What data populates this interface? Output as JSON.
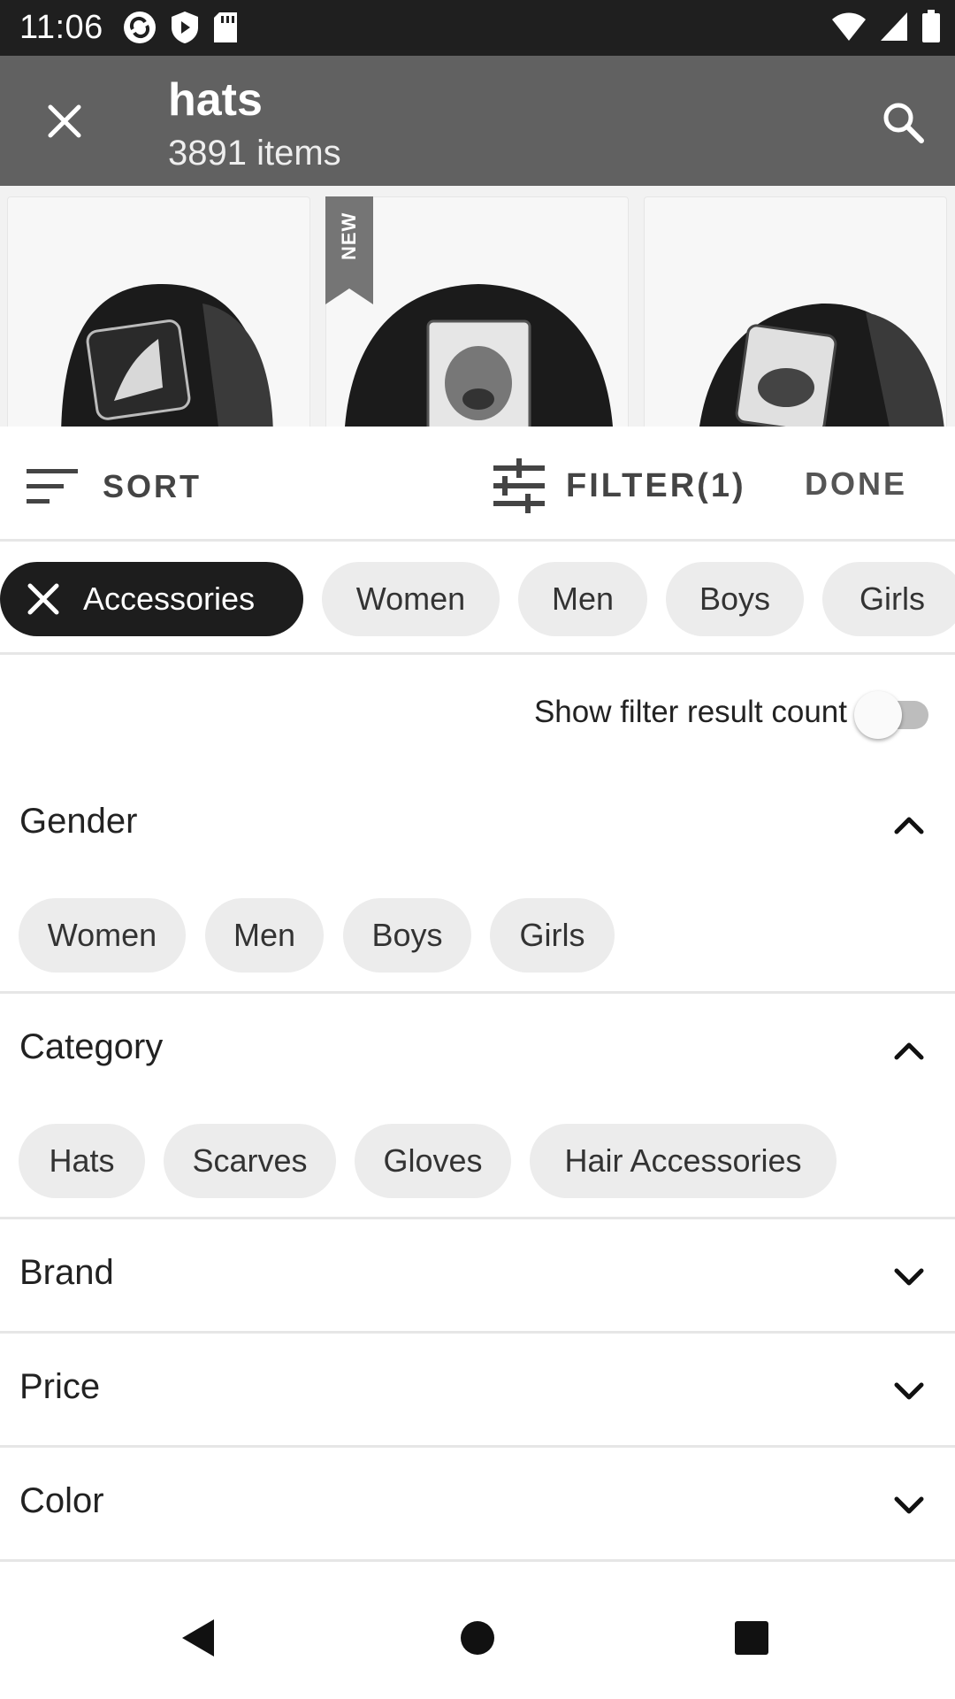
{
  "status_bar": {
    "time": "11:06"
  },
  "toolbar": {
    "title": "hats",
    "subtitle": "3891 items"
  },
  "products": {
    "badge": "NEW"
  },
  "controls": {
    "sort_label": "SORT",
    "filter_label": "FILTER(1)",
    "done_label": "DONE"
  },
  "quick_chips": [
    {
      "label": "Accessories",
      "selected": true
    },
    {
      "label": "Women",
      "selected": false
    },
    {
      "label": "Men",
      "selected": false
    },
    {
      "label": "Boys",
      "selected": false
    },
    {
      "label": "Girls",
      "selected": false
    }
  ],
  "result_count_toggle": {
    "label": "Show filter result count",
    "on": false
  },
  "sections": {
    "gender": {
      "title": "Gender",
      "expanded": true,
      "options": [
        "Women",
        "Men",
        "Boys",
        "Girls"
      ]
    },
    "category": {
      "title": "Category",
      "expanded": true,
      "options": [
        "Hats",
        "Scarves",
        "Gloves",
        "Hair Accessories"
      ]
    },
    "brand": {
      "title": "Brand",
      "expanded": false
    },
    "price": {
      "title": "Price",
      "expanded": false
    },
    "color": {
      "title": "Color",
      "expanded": false
    }
  },
  "colors": {
    "toolbar": "#616161",
    "selected_chip": "#1d1d1d",
    "chip": "#ececec"
  },
  "icons": [
    "close-icon",
    "search-icon",
    "sort-icon",
    "filter-sliders-icon",
    "chevron-up-icon",
    "chevron-down-icon",
    "back-icon",
    "home-icon",
    "recents-icon"
  ]
}
